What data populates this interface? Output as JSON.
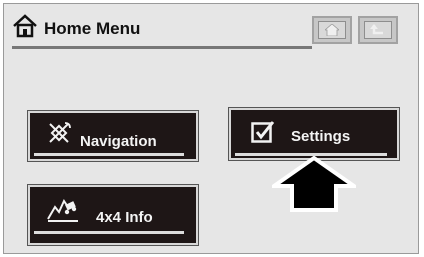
{
  "header": {
    "title": "Home Menu",
    "title_icon": "home-outline-icon",
    "buttons": [
      {
        "name": "home-button",
        "icon": "home-icon"
      },
      {
        "name": "back-button",
        "icon": "back-arrow-icon"
      }
    ]
  },
  "menu": {
    "navigation": {
      "label": "Navigation",
      "icon": "satellite-icon"
    },
    "settings": {
      "label": "Settings",
      "icon": "checkbox-checked-icon",
      "selected": true
    },
    "info": {
      "label": "4x4  Info",
      "icon": "terrain-icon"
    }
  },
  "pointer": {
    "icon": "up-arrow-pointer-icon"
  },
  "colors": {
    "screen_bg": "#e6e6e6",
    "button_bg": "#1e1616",
    "button_text": "#f4f4f4",
    "top_button_bg": "#c7c7c7"
  }
}
